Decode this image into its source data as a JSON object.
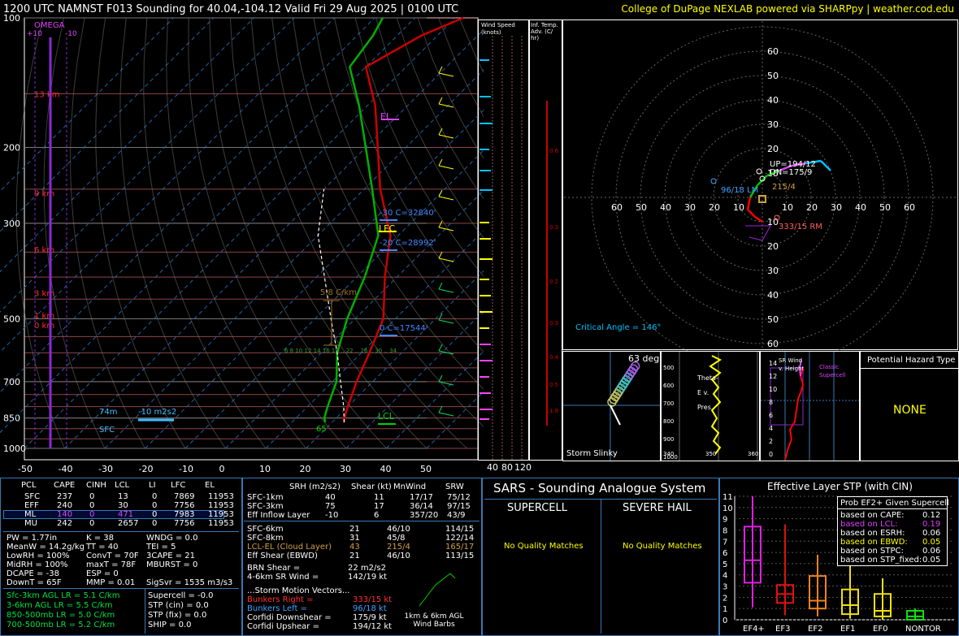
{
  "header": {
    "title": "1200 UTC NAMNST F013 Sounding for 40.04,-104.12 Valid  Fri 29 Aug 2025 | 0100 UTC",
    "credit": "College of DuPage NEXLAB powered via SHARPpy | weather.cod.edu"
  },
  "colors": {
    "background": "#000000",
    "temperature": "#cc0000",
    "dewpoint": "#00b000",
    "wetbulb": "#00c0ff",
    "parcel": "#ffffff",
    "panel_border": "#3a78b5",
    "isotherm": "#1f6fb8",
    "isobar": "#555555",
    "hodograph_ring": "#555555"
  },
  "skewt": {
    "omega_label": "OMEGA",
    "omega_scale": [
      "+10",
      "-10"
    ],
    "pressure_ticks": [
      "100",
      "200",
      "300",
      "500",
      "700",
      "850",
      "1000"
    ],
    "temp_ticks": [
      "-50",
      "-40",
      "-30",
      "-20",
      "-10",
      "0",
      "10",
      "20",
      "30",
      "40",
      "50"
    ],
    "height_labels": [
      "13 km",
      "9 km",
      "6 km",
      "3 km",
      "1 km",
      "0 km"
    ],
    "annotations": {
      "el": "EL",
      "lfc": "LFC",
      "lcl": "LCL",
      "minus30": "-30 C=32840'",
      "minus20": "-20 C=28992'",
      "zero": "0 C=17544'",
      "lapse": "5.8 C/km",
      "eff_inflow_top": "74m",
      "eff_srh": "-10 m2s2",
      "sfc": "SFC",
      "surface_dew": "65",
      "mini_levels": "6  8  10  12  14  16  18 .. 22 .. 26 .. 30 .. 34"
    }
  },
  "chart_data": [
    {
      "type": "line",
      "title": "",
      "xlabel": "",
      "ylabel": "",
      "xlim": [
        -50,
        50
      ],
      "ylim": [
        1050,
        100
      ],
      "yscale": "log",
      "skew": "skew-T",
      "series": [
        {
          "name": "temperature",
          "points": [
            [
              23,
              870
            ],
            [
              22,
              850
            ],
            [
              20,
              800
            ],
            [
              16,
              700
            ],
            [
              12,
              600
            ],
            [
              7,
              500
            ],
            [
              -3,
              400
            ],
            [
              -12,
              320
            ],
            [
              -26,
              250
            ],
            [
              -37,
              200
            ],
            [
              -48,
              160
            ],
            [
              -60,
              130
            ],
            [
              -54,
              110
            ],
            [
              -48,
              100
            ]
          ]
        },
        {
          "name": "dewpoint",
          "points": [
            [
              18.3,
              870
            ],
            [
              17,
              850
            ],
            [
              15,
              800
            ],
            [
              11,
              700
            ],
            [
              4,
              600
            ],
            [
              -2,
              500
            ],
            [
              -8,
              400
            ],
            [
              -15,
              320
            ],
            [
              -28,
              250
            ],
            [
              -40,
              200
            ],
            [
              -52,
              160
            ],
            [
              -64,
              130
            ],
            [
              -66,
              110
            ],
            [
              -68,
              100
            ]
          ]
        },
        {
          "name": "parcel",
          "points": [
            [
              23,
              870
            ],
            [
              19,
              800
            ],
            [
              12,
              700
            ],
            [
              4,
              600
            ],
            [
              -6,
              500
            ],
            [
              -18,
              400
            ],
            [
              -30,
              320
            ],
            [
              -40,
              250
            ]
          ]
        }
      ]
    },
    {
      "type": "scatter",
      "title": "",
      "xlim": [
        -70,
        70
      ],
      "ylim": [
        -70,
        70
      ],
      "ring_labels": [
        "10",
        "20",
        "30",
        "40",
        "50",
        "60"
      ],
      "series": [
        {
          "name": "hodograph",
          "points": [
            [
              0,
              -10
            ],
            [
              -3,
              -8
            ],
            [
              -6,
              -5
            ],
            [
              -5,
              0
            ],
            [
              -2,
              5
            ],
            [
              2,
              9
            ],
            [
              7,
              11
            ],
            [
              12,
              13
            ],
            [
              18,
              14
            ],
            [
              24,
              15
            ],
            [
              28,
              11
            ]
          ]
        }
      ],
      "labels": {
        "up": "UP=194/12",
        "dn": "DN=175/9",
        "lm": "96/18 LM",
        "rm": "333/15 RM",
        "mean": "215/4",
        "critical_angle": "Critical Angle = 146°"
      }
    },
    {
      "type": "bar",
      "title": "Effective Layer STP (with CIN)",
      "categories": [
        "EF4+",
        "EF3",
        "EF2",
        "EF1",
        "EF0",
        "NONTOR"
      ],
      "ylim": [
        0,
        11
      ],
      "yticks": [
        "0",
        "1",
        "2",
        "3",
        "4",
        "5",
        "6",
        "7",
        "8",
        "9",
        "10",
        "11"
      ],
      "boxes": [
        {
          "low": 1.1,
          "q1": 3.3,
          "median": 5.3,
          "q3": 8.3,
          "high": 11
        },
        {
          "low": 0.4,
          "q1": 1.5,
          "median": 2.3,
          "q3": 3.1,
          "high": 8.5
        },
        {
          "low": 0.3,
          "q1": 1.0,
          "median": 1.7,
          "q3": 3.9,
          "high": 5.8
        },
        {
          "low": 0.1,
          "q1": 0.5,
          "median": 1.3,
          "q3": 2.7,
          "high": 4.9
        },
        {
          "low": 0.0,
          "q1": 0.3,
          "median": 0.8,
          "q3": 2.3,
          "high": 3.7
        },
        {
          "low": 0.0,
          "q1": 0.0,
          "median": 0.3,
          "q3": 0.8,
          "high": 1.0
        }
      ],
      "colors": [
        "#e01fe0",
        "#e01010",
        "#f08020",
        "#f0e010",
        "#f0e010",
        "#10e010"
      ]
    }
  ],
  "side_panels": {
    "wind_speed_title": "Wind Speed (knots)",
    "wind_speed_ticks": [
      "40",
      "80",
      "120"
    ],
    "inf_temp_title": "Inf. Temp. Adv. (C/ hr)",
    "inf_temp_values": [
      "0.6",
      "0.3",
      "0.2",
      "0.3",
      "0.4",
      "0.5",
      "1.8"
    ]
  },
  "slinky": {
    "angle": "63 deg",
    "title": "Storm Slinky"
  },
  "theta": {
    "title": "Theta-E v. Pres",
    "ticks": [
      "500",
      "600",
      "700",
      "800",
      "900",
      "1000"
    ],
    "bottom": [
      "340",
      "350",
      "360"
    ]
  },
  "srwind": {
    "title": "SR Wind v. Height",
    "class": "Classic Supercell",
    "ticks": [
      "14",
      "12",
      "10",
      "8",
      "6",
      "4",
      "2",
      "0"
    ],
    "bottom": [
      "0",
      "20",
      "40"
    ]
  },
  "hazard": {
    "title": "Potential Hazard Type",
    "value": "NONE"
  },
  "parcels": {
    "headers": [
      "PCL",
      "CAPE",
      "CINH",
      "LCL",
      "LI",
      "LFC",
      "EL"
    ],
    "rows": [
      [
        "SFC",
        "237",
        "0",
        "13",
        "0",
        "7869",
        "11953"
      ],
      [
        "EFF",
        "240",
        "0",
        "30",
        "0",
        "7756",
        "11953"
      ],
      [
        "ML",
        "140",
        "0",
        "471",
        "0",
        "7983",
        "11953"
      ],
      [
        "MU",
        "242",
        "0",
        "2657",
        "0",
        "7756",
        "11953"
      ]
    ]
  },
  "thermo": [
    [
      "PW = 1.77in",
      "K = 38",
      "WNDG = 0.0"
    ],
    [
      "MeanW = 14.2g/kg",
      "TT = 40",
      "TEI = 5"
    ],
    [
      "LowRH = 100%",
      "ConvT = 70F",
      "3CAPE = 21"
    ],
    [
      "MidRH = 100%",
      "maxT = 78F",
      "MBURST = 0"
    ],
    [
      "DCAPE = -38",
      "ESP = 0",
      ""
    ],
    [
      "DownT = 65F",
      "MMP = 0.01",
      "SigSvr = 1535 m3/s3"
    ]
  ],
  "lapse_rates": [
    "Sfc-3km AGL LR = 5.1 C/km",
    "3-6km AGL LR = 5.5 C/km",
    "850-500mb LR = 5.0 C/km",
    "700-500mb LR = 5.2 C/km"
  ],
  "indices": [
    "Supercell = -0.0",
    "STP (cin) = 0.0",
    "STP (fix) = 0.0",
    "SHIP = 0.0"
  ],
  "kinematics": {
    "headers": [
      "SRH (m2/s2)",
      "Shear (kt)",
      "MnWind",
      "SRW"
    ],
    "rows": [
      [
        "SFC-1km",
        "40",
        "11",
        "17/17",
        "75/12"
      ],
      [
        "SFC-3km",
        "75",
        "17",
        "36/14",
        "97/15"
      ],
      [
        "Eff Inflow Layer",
        "-10",
        "6",
        "357/20",
        "43/9"
      ],
      [
        "SFC-6km",
        "21",
        "46/10",
        "114/15",
        ""
      ],
      [
        "SFC-8km",
        "31",
        "45/8",
        "122/14",
        ""
      ],
      [
        "LCL-EL (Cloud Layer)",
        "43",
        "215/4",
        "165/17",
        ""
      ],
      [
        "Eff Shear (EBWD)",
        "21",
        "46/10",
        "113/15",
        ""
      ]
    ],
    "brn": [
      "BRN Shear =",
      "22 m2/s2"
    ],
    "sr46": [
      "4-6km SR Wind =",
      "142/19 kt"
    ],
    "motion_title": "...Storm Motion Vectors...",
    "motions": [
      [
        "Bunkers Right =",
        "333/15 kt"
      ],
      [
        "Bunkers Left =",
        "96/18 kt"
      ],
      [
        "Corfidi Downshear =",
        "175/9 kt"
      ],
      [
        "Corfidi Upshear =",
        "194/12 kt"
      ]
    ],
    "barb_caption": "1km & 6km AGL Wind Barbs"
  },
  "sars": {
    "title": "SARS - Sounding Analogue System",
    "supercell": "SUPERCELL",
    "hail": "SEVERE HAIL",
    "supercell_msg": "No Quality Matches",
    "hail_msg": "No Quality Matches"
  },
  "stp_prob": {
    "title": "Prob EF2+ Given Supercell",
    "rows": [
      [
        "based on CAPE:",
        "0.12"
      ],
      [
        "based on LCL:",
        "0.19"
      ],
      [
        "based on ESRH:",
        "0.06"
      ],
      [
        "based on EBWD:",
        "0.05"
      ],
      [
        "based on STPC:",
        "0.06"
      ],
      [
        "based on STP_fixed:",
        "0.05"
      ]
    ]
  }
}
